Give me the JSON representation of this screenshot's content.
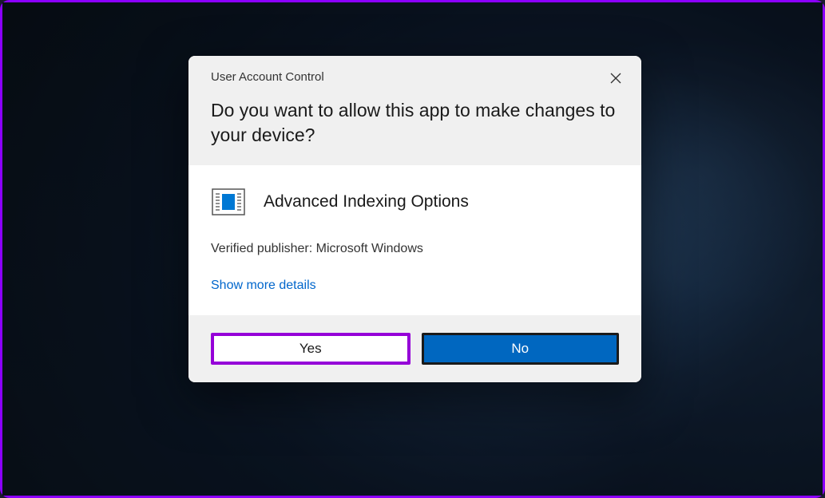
{
  "dialog": {
    "title": "User Account Control",
    "question": "Do you want to allow this app to make changes to your device?",
    "app_name": "Advanced Indexing Options",
    "publisher_label": "Verified publisher: Microsoft Windows",
    "details_link": "Show more details",
    "yes_label": "Yes",
    "no_label": "No"
  }
}
